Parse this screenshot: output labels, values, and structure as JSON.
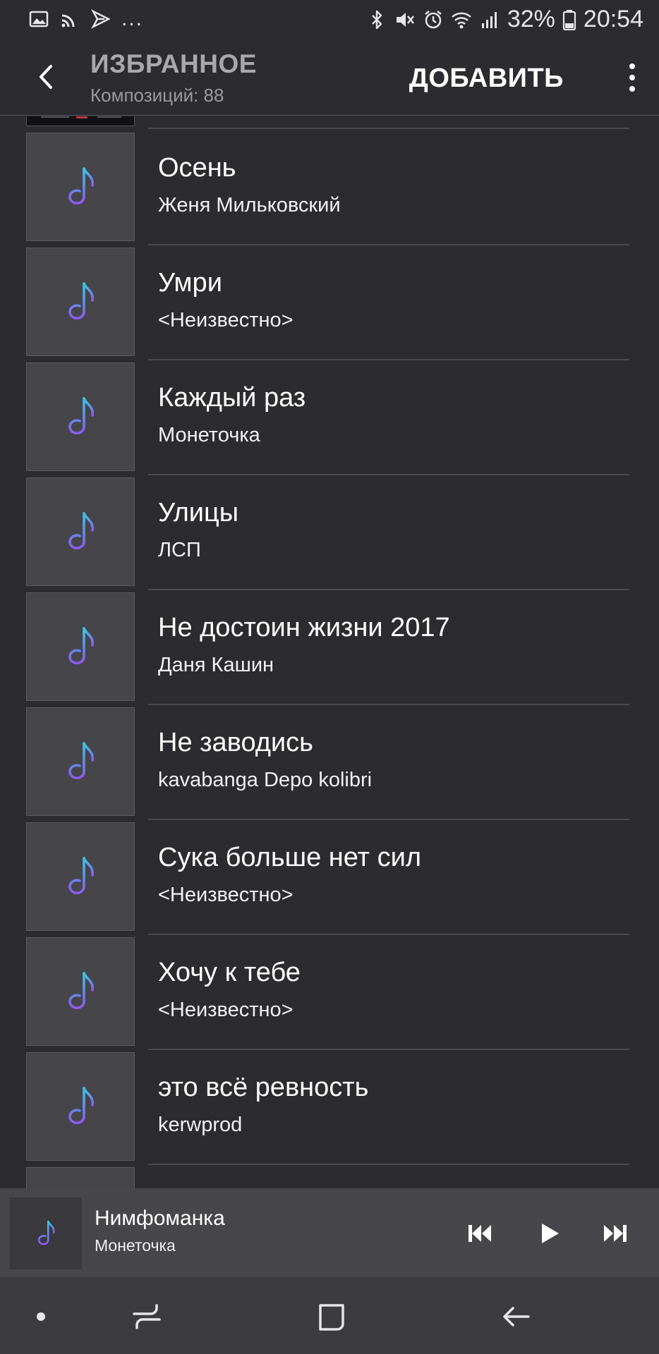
{
  "status_bar": {
    "left_icons": [
      "gallery-icon",
      "cast-icon",
      "flipboard-icon"
    ],
    "more_indicator": "...",
    "right_icons": [
      "bluetooth-icon",
      "mute-icon",
      "alarm-icon",
      "wifi-icon",
      "signal-icon",
      "battery-icon"
    ],
    "battery": "32%",
    "time": "20:54"
  },
  "header": {
    "back_icon": "chevron-left-icon",
    "title": "ИЗБРАННОЕ",
    "subtitle": "Композиций: 88",
    "add_label": "ДОБАВИТЬ",
    "more_icon": "more-vertical-icon"
  },
  "tracks": [
    {
      "title": "Осень",
      "artist": "Женя Мильковский"
    },
    {
      "title": "Умри",
      "artist": "<Неизвестно>"
    },
    {
      "title": "Каждый раз",
      "artist": "Монеточка"
    },
    {
      "title": "Улицы",
      "artist": "ЛСП"
    },
    {
      "title": "Не достоин жизни 2017",
      "artist": "Даня Кашин"
    },
    {
      "title": "Не заводись",
      "artist": "kavabanga Depo kolibri"
    },
    {
      "title": "Сука больше нет сил",
      "artist": "<Неизвестно>"
    },
    {
      "title": "Хочу к тебе",
      "artist": "<Неизвестно>"
    },
    {
      "title": "это всё ревность",
      "artist": "kerwprod"
    }
  ],
  "now_playing": {
    "title": "Нимфоманка",
    "artist": "Монеточка",
    "controls": [
      "previous-icon",
      "play-icon",
      "next-icon"
    ]
  },
  "nav_bar": {
    "buttons": [
      "dot-icon",
      "recents-icon",
      "home-icon",
      "back-arrow-icon"
    ]
  },
  "colors": {
    "background": "#2c2b30",
    "note_gradient_top": "#38c8e0",
    "note_gradient_bottom": "#8a5cf0",
    "player_bg": "#47464b",
    "nav_bg": "#3c3b40"
  }
}
